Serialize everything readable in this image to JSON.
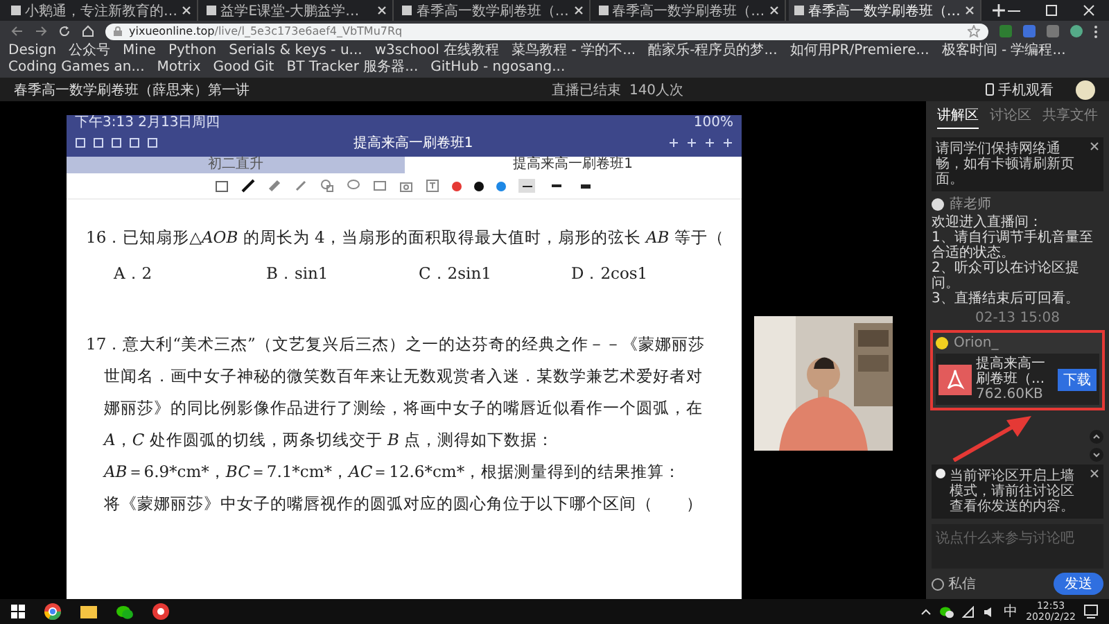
{
  "browser": {
    "tabs": [
      {
        "title": "小鹅通，专注新教育的…",
        "selected": false
      },
      {
        "title": "益学E课堂-大鹏益学…",
        "selected": false
      },
      {
        "title": "春季高一数学刷卷班（…",
        "selected": false
      },
      {
        "title": "春季高一数学刷卷班（…",
        "selected": false
      },
      {
        "title": "春季高一数学刷卷班（…",
        "selected": true
      }
    ],
    "url_host": "yixueonline.top",
    "url_path": "/live/l_5e3c173e6aef4_VbTMu7Rq",
    "bookmarks": [
      "Design",
      "公众号",
      "Mine",
      "Python",
      "Serials & keys - u...",
      "w3school 在线教程",
      "菜鸟教程 - 学的不...",
      "酷家乐-程序员的梦...",
      "如何用PR/Premiere...",
      "极客时间 - 学编程...",
      "Coding Games an...",
      "Motrix",
      "Good Git",
      "BT Tracker 服务器...",
      "GitHub - ngosang..."
    ]
  },
  "header": {
    "title": "春季高一数学刷卷班（薛思来）第一讲",
    "status": "直播已结束",
    "views": "140人次",
    "mobile": "手机观看"
  },
  "tablet": {
    "status_time": "下午3:13 2月13日周四",
    "battery": "100%",
    "doc_title": "提高来高一刷卷班1",
    "doc_tabs": [
      {
        "label": "初二直升",
        "selected": false
      },
      {
        "label": "提高来高一刷卷班1",
        "selected": true
      }
    ],
    "pen_colors": [
      {
        "color": "#e53935",
        "selected": false
      },
      {
        "color": "#111111",
        "selected": false
      },
      {
        "color": "#1e88e5",
        "selected": false
      }
    ],
    "stroke_widths": [
      {
        "selected": true
      },
      {
        "selected": false
      },
      {
        "selected": false
      }
    ]
  },
  "problem_16": {
    "stem": "16．已知扇形△*AOB* 的周长为 4，当扇形的面积取得最大值时，扇形的弦长 *AB* 等于（",
    "options": [
      "A．2",
      "B．sin1",
      "C．2sin1",
      "D．2cos1"
    ]
  },
  "problem_17": {
    "lines": [
      "17．意大利“美术三杰”（文艺复兴后三杰）之一的达芬奇的经典之作－－《蒙娜丽莎",
      "世闻名．画中女子神秘的微笑数百年来让无数观赏者入迷．某数学兼艺术爱好者对",
      "娜丽莎》的同比例影像作品进行了测绘，将画中女子的嘴唇近似看作一个圆弧，在",
      "*A*，*C* 处作圆弧的切线，两条切线交于 *B* 点，测得如下数据：",
      "*AB*＝6.9*cm*，*BC*＝7.1*cm*，*AC*＝12.6*cm*，根据测量得到的结果推算：",
      "将《蒙娜丽莎》中女子的嘴唇视作的圆弧对应的圆心角位于以下哪个区间（　　）"
    ]
  },
  "sidebar": {
    "tabs": [
      {
        "label": "讲解区",
        "selected": true
      },
      {
        "label": "讨论区",
        "selected": false
      },
      {
        "label": "共享文件",
        "selected": false
      }
    ],
    "notice": "请同学们保持网络通畅，如有卡顿请刷新页面。",
    "teacher": {
      "name": "薛老师",
      "lines": [
        "欢迎进入直播间：",
        "1、请自行调节手机音量至合适的状态。",
        "2、听众可以在讨论区提问。",
        "3、直播结束后可回看。"
      ]
    },
    "time": "02-13 15:08",
    "file_message": {
      "sender": "Orion_",
      "file_name": "提高来高一刷卷班（...",
      "size": "762.60KB",
      "button": "下载"
    },
    "tip": "当前评论区开启上墙模式，请前往讨论区查看你发送的内容。",
    "input_placeholder": "说点什么来参与讨论吧",
    "private_label": "私信",
    "private_checked": false,
    "send": "发送"
  },
  "taskbar": {
    "ime": "中",
    "time": "12:53",
    "date": "2020/2/22"
  }
}
